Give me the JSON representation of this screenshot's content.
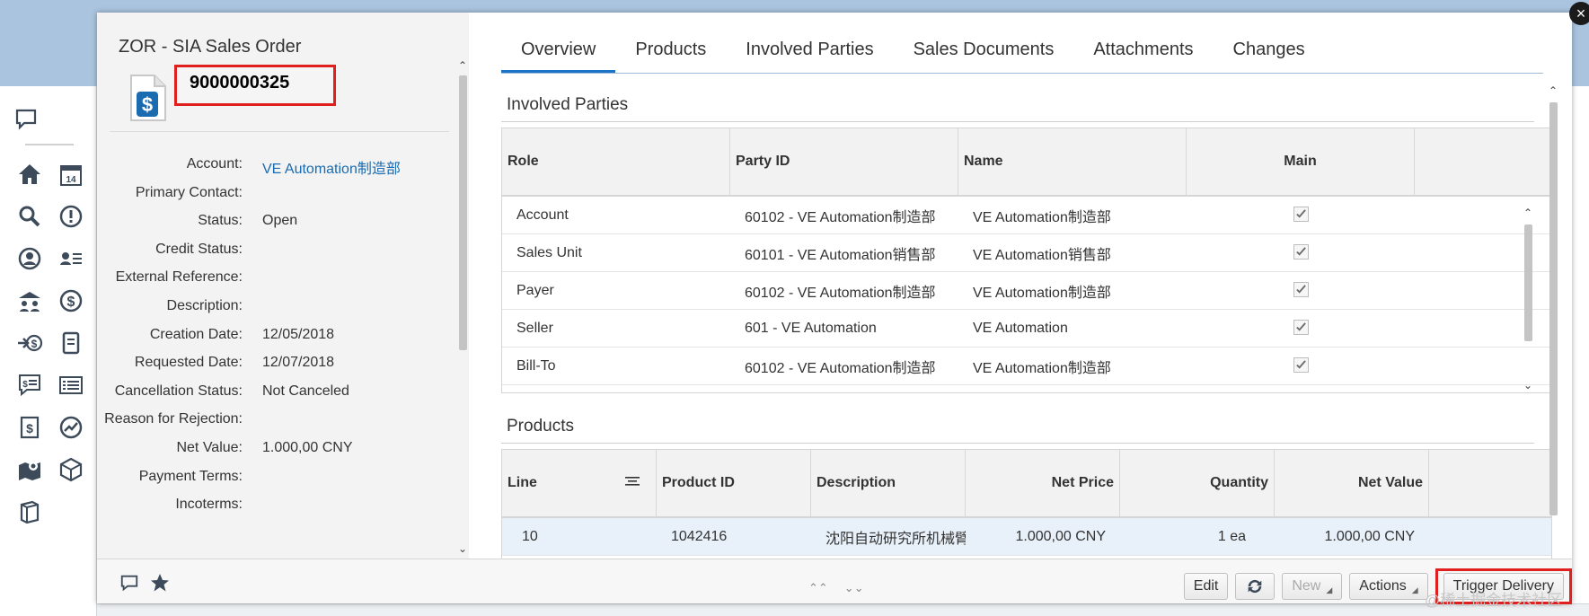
{
  "order": {
    "title": "ZOR - SIA Sales Order",
    "id": "9000000325"
  },
  "fields": [
    {
      "label": "Account:",
      "value": "VE Automation制造部",
      "link": true
    },
    {
      "label": "Primary Contact:",
      "value": ""
    },
    {
      "label": "Status:",
      "value": "Open"
    },
    {
      "label": "Credit Status:",
      "value": ""
    },
    {
      "label": "External Reference:",
      "value": ""
    },
    {
      "label": "Description:",
      "value": ""
    },
    {
      "label": "Creation Date:",
      "value": "12/05/2018"
    },
    {
      "label": "Requested Date:",
      "value": "12/07/2018"
    },
    {
      "label": "Cancellation Status:",
      "value": "Not Canceled"
    },
    {
      "label": "Reason for Rejection:",
      "value": ""
    },
    {
      "label": "Net Value:",
      "value": "1.000,00 CNY"
    },
    {
      "label": "Payment Terms:",
      "value": ""
    },
    {
      "label": "Incoterms:",
      "value": ""
    }
  ],
  "tabs": [
    "Overview",
    "Products",
    "Involved Parties",
    "Sales Documents",
    "Attachments",
    "Changes"
  ],
  "active_tab": "Overview",
  "involved_parties": {
    "title": "Involved Parties",
    "columns": [
      "Role",
      "Party ID",
      "Name",
      "Main"
    ],
    "rows": [
      {
        "role": "Account",
        "party_id": "60102 - VE Automation制造部",
        "name": "VE Automation制造部",
        "main": true
      },
      {
        "role": "Sales Unit",
        "party_id": "60101 - VE Automation销售部",
        "name": "VE Automation销售部",
        "main": true
      },
      {
        "role": "Payer",
        "party_id": "60102 - VE Automation制造部",
        "name": "VE Automation制造部",
        "main": true
      },
      {
        "role": "Seller",
        "party_id": "601 - VE Automation",
        "name": "VE Automation",
        "main": true
      },
      {
        "role": "Bill-To",
        "party_id": "60102 - VE Automation制造部",
        "name": "VE Automation制造部",
        "main": true
      }
    ]
  },
  "products": {
    "title": "Products",
    "columns": [
      "Line",
      "Product ID",
      "Description",
      "Net Price",
      "Quantity",
      "Net Value"
    ],
    "rows": [
      {
        "line": "10",
        "product_id": "1042416",
        "description": "沈阳自动研究所机械臂A",
        "net_price": "1.000,00  CNY",
        "quantity": "1  ea",
        "net_value": "1.000,00  CNY"
      }
    ]
  },
  "footer": {
    "edit": "Edit",
    "new": "New",
    "actions": "Actions",
    "trigger_delivery": "Trigger Delivery"
  },
  "watermark": "@稀土掘金技术社区",
  "colors": {
    "accent": "#1a73c4",
    "link": "#1a6bb0",
    "highlight": "#e0201e"
  }
}
